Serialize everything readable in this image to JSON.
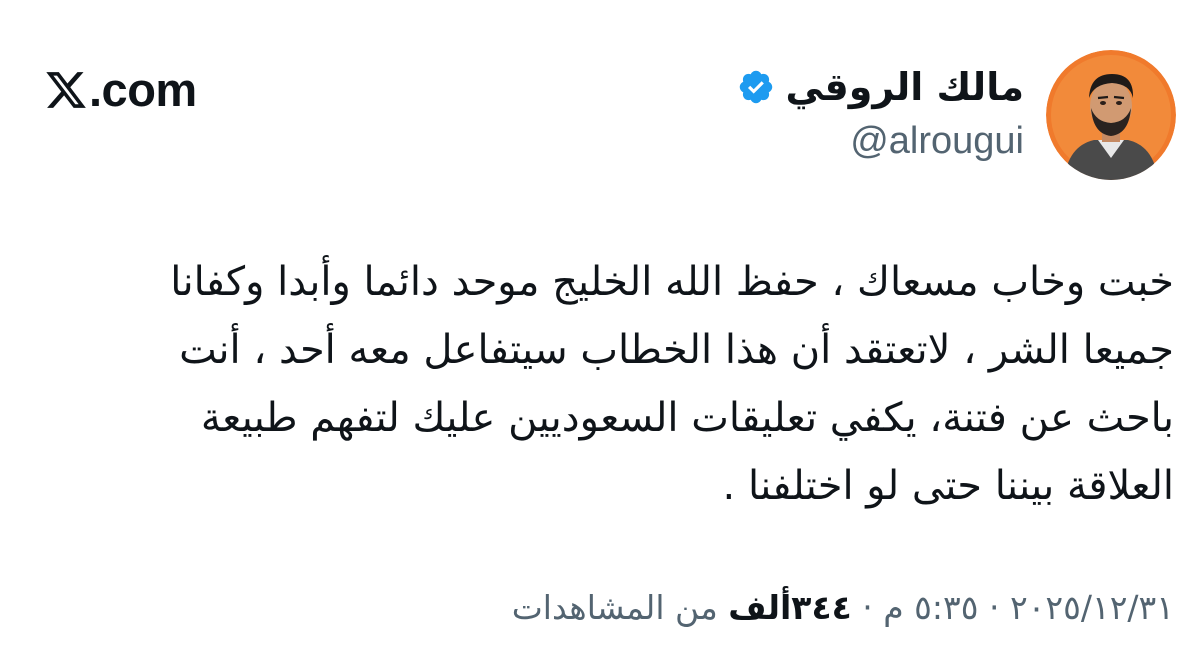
{
  "site": {
    "label": ".com",
    "logo_icon": "x-logo-icon"
  },
  "author": {
    "display_name": "مالك الروقي",
    "handle": "@alrougui",
    "verified_icon": "verified-badge-icon",
    "avatar_icon": "avatar-portrait"
  },
  "tweet": {
    "lines": [
      "خبت وخاب مسعاك ، حفظ الله الخليج موحد دائما وأبدا وكفانا",
      "جميعا الشر ، لاتعتقد أن هذا الخطاب سيتفاعل معه أحد ، أنت",
      "باحث عن فتنة، يكفي تعليقات السعوديين عليك لتفهم طبيعة",
      "العلاقة بيننا حتى لو اختلفنا ."
    ]
  },
  "meta": {
    "date": "٢٠٢٥/١٢/٣١",
    "separator": "·",
    "time": "٥:٣٥ م",
    "views_count": "٣٤٤ألف",
    "views_label": "من المشاهدات"
  },
  "colors": {
    "verified": "#1d9bf0",
    "secondary_text": "#536471",
    "primary_text": "#0f1419",
    "avatar_bg": "#f07a2c"
  }
}
